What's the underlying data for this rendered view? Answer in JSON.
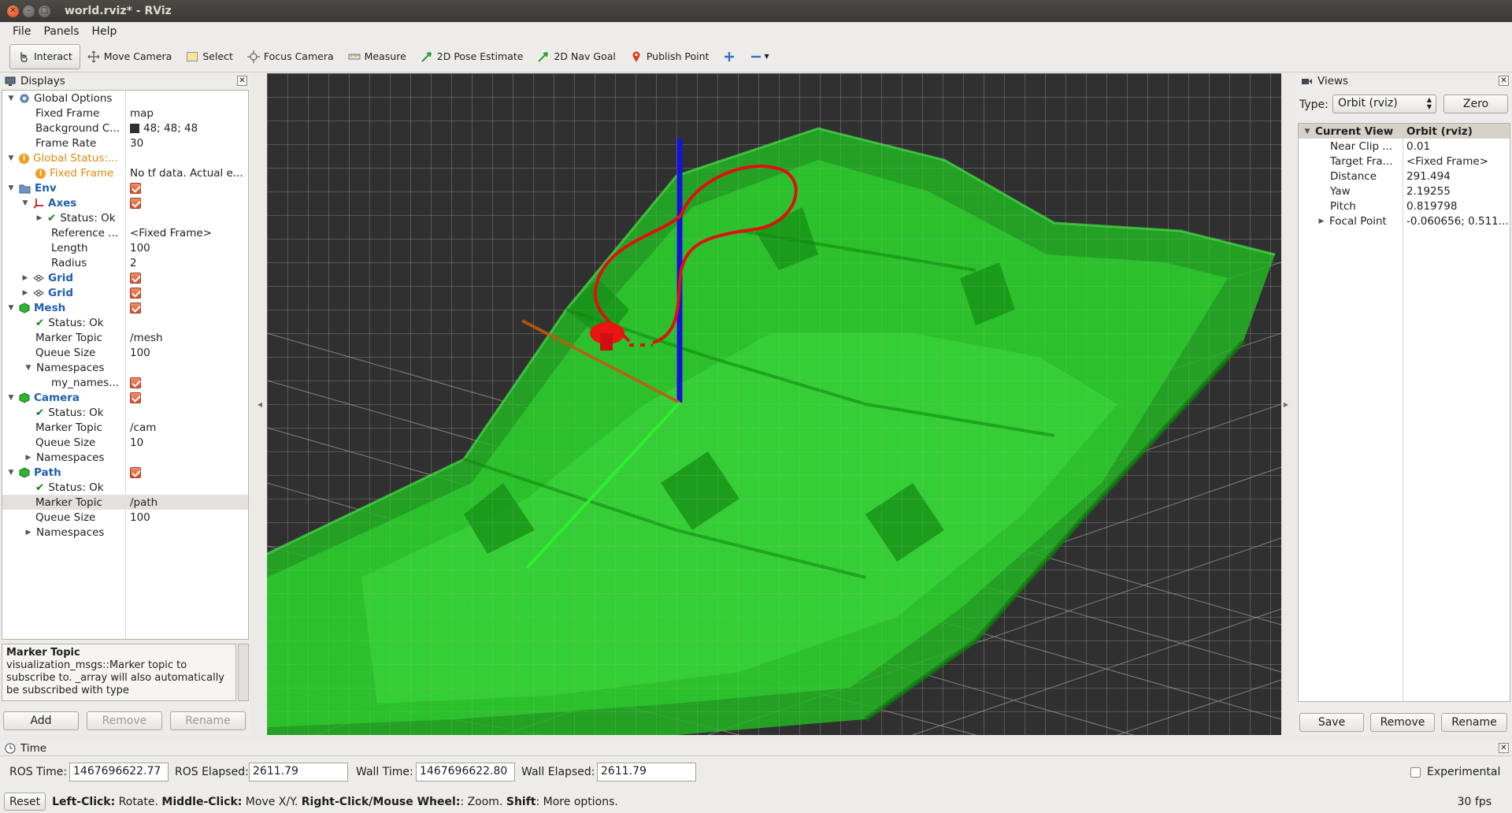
{
  "window": {
    "title": "world.rviz* - RViz"
  },
  "menubar": {
    "items": [
      "File",
      "Panels",
      "Help"
    ]
  },
  "toolbar": {
    "tools": [
      {
        "label": "Interact",
        "icon": "cursor-icon",
        "active": true
      },
      {
        "label": "Move Camera",
        "icon": "move-camera-icon"
      },
      {
        "label": "Select",
        "icon": "select-icon"
      },
      {
        "label": "Focus Camera",
        "icon": "focus-camera-icon"
      },
      {
        "label": "Measure",
        "icon": "measure-icon"
      },
      {
        "label": "2D Pose Estimate",
        "icon": "pose-estimate-arrow-icon"
      },
      {
        "label": "2D Nav Goal",
        "icon": "nav-goal-arrow-icon"
      },
      {
        "label": "Publish Point",
        "icon": "map-pin-icon"
      }
    ]
  },
  "displays": {
    "title": "Displays",
    "rows": [
      {
        "name": "Global Options"
      },
      {
        "name": "Fixed Frame",
        "value": "map"
      },
      {
        "name": "Background C...",
        "value": "48; 48; 48"
      },
      {
        "name": "Frame Rate",
        "value": "30"
      },
      {
        "name": "Global Status:..."
      },
      {
        "name": "Fixed Frame",
        "value": "No tf data.  Actual e..."
      },
      {
        "name": "Env"
      },
      {
        "name": "Axes"
      },
      {
        "name": "Status: Ok"
      },
      {
        "name": "Reference ...",
        "value": "<Fixed Frame>"
      },
      {
        "name": "Length",
        "value": "100"
      },
      {
        "name": "Radius",
        "value": "2"
      },
      {
        "name": "Grid"
      },
      {
        "name": "Grid"
      },
      {
        "name": "Mesh"
      },
      {
        "name": "Status: Ok"
      },
      {
        "name": "Marker Topic",
        "value": "/mesh"
      },
      {
        "name": "Queue Size",
        "value": "100"
      },
      {
        "name": "Namespaces"
      },
      {
        "name": "my_names..."
      },
      {
        "name": "Camera"
      },
      {
        "name": "Status: Ok"
      },
      {
        "name": "Marker Topic",
        "value": "/cam"
      },
      {
        "name": "Queue Size",
        "value": "10"
      },
      {
        "name": "Namespaces"
      },
      {
        "name": "Path"
      },
      {
        "name": "Status: Ok"
      },
      {
        "name": "Marker Topic",
        "value": "/path"
      },
      {
        "name": "Queue Size",
        "value": "100"
      },
      {
        "name": "Namespaces"
      }
    ],
    "description": {
      "title": "Marker Topic",
      "text": "visualization_msgs::Marker topic to subscribe to. _array will also automatically be subscribed with type"
    },
    "buttons": {
      "add": "Add",
      "remove": "Remove",
      "rename": "Rename"
    }
  },
  "views": {
    "title": "Views",
    "type_label": "Type:",
    "type_value": "Orbit (rviz)",
    "zero_label": "Zero",
    "rows": [
      {
        "name": "Current View",
        "value": "Orbit (rviz)"
      },
      {
        "name": "Near Clip ...",
        "value": "0.01"
      },
      {
        "name": "Target Fra...",
        "value": "<Fixed Frame>"
      },
      {
        "name": "Distance",
        "value": "291.494"
      },
      {
        "name": "Yaw",
        "value": "2.19255"
      },
      {
        "name": "Pitch",
        "value": "0.819798"
      },
      {
        "name": "Focal Point",
        "value": "-0.060656; 0.511..."
      }
    ],
    "buttons": {
      "save": "Save",
      "remove": "Remove",
      "rename": "Rename"
    }
  },
  "time": {
    "title": "Time",
    "ros_time_label": "ROS Time:",
    "ros_time": "1467696622.77",
    "ros_elapsed_label": "ROS Elapsed:",
    "ros_elapsed": "2611.79",
    "wall_time_label": "Wall Time:",
    "wall_time": "1467696622.80",
    "wall_elapsed_label": "Wall Elapsed:",
    "wall_elapsed": "2611.79",
    "experimental_label": "Experimental"
  },
  "status": {
    "reset_label": "Reset",
    "left_click_b": "Left-Click:",
    "left_click_t": " Rotate. ",
    "middle_click_b": "Middle-Click:",
    "middle_click_t": " Move X/Y. ",
    "right_click_b": "Right-Click/Mouse Wheel:",
    "right_click_t": ": Zoom. ",
    "shift_b": "Shift",
    "shift_t": ": More options.",
    "fps": "30 fps"
  },
  "colors": {
    "background": "#303030",
    "mesh": "#1fd01f",
    "path": "#e01010",
    "axis_z": "#1010e0"
  }
}
